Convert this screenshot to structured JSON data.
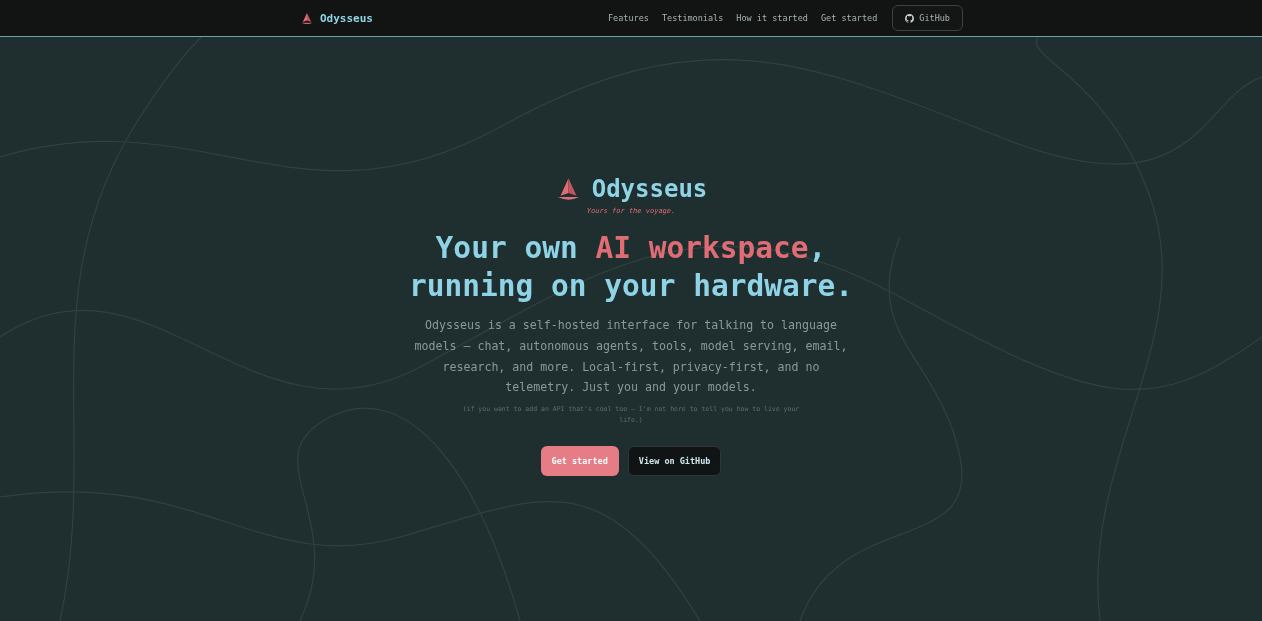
{
  "nav": {
    "brand": "Odysseus",
    "links": [
      "Features",
      "Testimonials",
      "How it started",
      "Get started"
    ],
    "github": "GitHub"
  },
  "hero": {
    "title": "Odysseus",
    "tagline": "Yours for the voyage.",
    "headline": [
      {
        "text": "Your own ",
        "accent": false
      },
      {
        "text": "AI workspace",
        "accent": true
      },
      {
        "text": ",",
        "accent": false
      },
      {
        "text": "running on your hardware.",
        "accent": false,
        "break": true
      }
    ],
    "description": "Odysseus is a self-hosted interface for talking to language models — chat, autonomous agents, tools, model serving, email, research, and more. Local-first, privacy-first, and no telemetry. Just you and your models.",
    "note": "(if you want to add an API that's cool too — I'm not here to tell you how to live your life.)",
    "buttons": [
      {
        "label": "Get started",
        "kind": "primary"
      },
      {
        "label": "View on GitHub",
        "kind": "secondary"
      }
    ]
  }
}
